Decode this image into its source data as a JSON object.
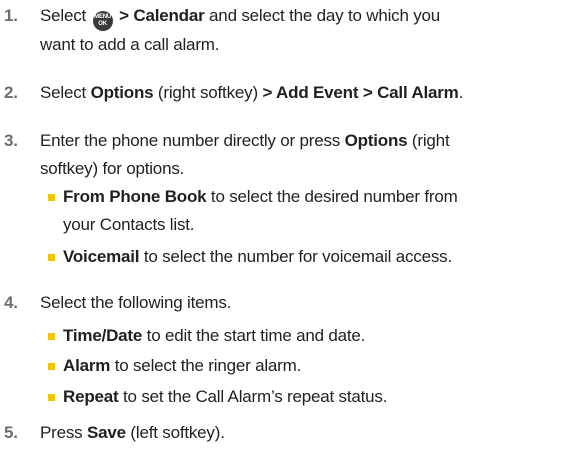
{
  "colors": {
    "text": "#231f20",
    "number": "#6d6e71",
    "bullet": "#f2c500"
  },
  "menu_key": {
    "icon": "menu-ok-key-icon",
    "line1": "MENU",
    "line2": "OK"
  },
  "steps": [
    {
      "number": "1.",
      "pre": "Select",
      "bold1": "> Calendar",
      "rest1": " and select the day to which you",
      "line2": "want to add a call alarm."
    },
    {
      "number": "2.",
      "pre": "Select ",
      "bold1": "Options",
      "mid1": " (right softkey) ",
      "bold2": "> Add Event > Call Alarm",
      "end": "."
    },
    {
      "number": "3.",
      "line1_pre": "Enter the phone number directly or press ",
      "line1_bold": "Options",
      "line1_post": " (right",
      "line2": "softkey) for options.",
      "bullets": [
        {
          "bold": "From Phone Book",
          "text": " to select the desired number from",
          "line2": "your Contacts list."
        },
        {
          "bold": "Voicemail",
          "text": " to select the number for voicemail access."
        }
      ]
    },
    {
      "number": "4.",
      "text": "Select the following items.",
      "bullets": [
        {
          "bold": "Time/Date",
          "text": " to edit the start time and date."
        },
        {
          "bold": "Alarm",
          "text": " to select the ringer alarm."
        },
        {
          "bold": "Repeat",
          "text": " to set the Call Alarm’s repeat status."
        }
      ]
    },
    {
      "number": "5.",
      "pre": "Press ",
      "bold1": "Save",
      "post": " (left softkey)."
    }
  ]
}
